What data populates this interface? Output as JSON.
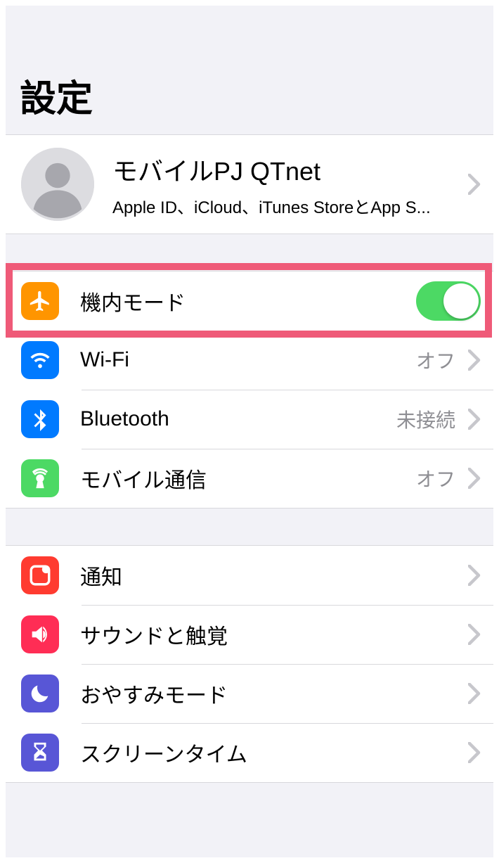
{
  "header": {
    "title": "設定"
  },
  "profile": {
    "name": "モバイルPJ QTnet",
    "subtitle": "Apple ID、iCloud、iTunes StoreとApp S..."
  },
  "group1": {
    "airplane": {
      "label": "機内モード",
      "on": true
    },
    "wifi": {
      "label": "Wi-Fi",
      "value": "オフ"
    },
    "bluetooth": {
      "label": "Bluetooth",
      "value": "未接続"
    },
    "cellular": {
      "label": "モバイル通信",
      "value": "オフ"
    }
  },
  "group2": {
    "notifications": {
      "label": "通知"
    },
    "sounds": {
      "label": "サウンドと触覚"
    },
    "dnd": {
      "label": "おやすみモード"
    },
    "screentime": {
      "label": "スクリーンタイム"
    }
  }
}
